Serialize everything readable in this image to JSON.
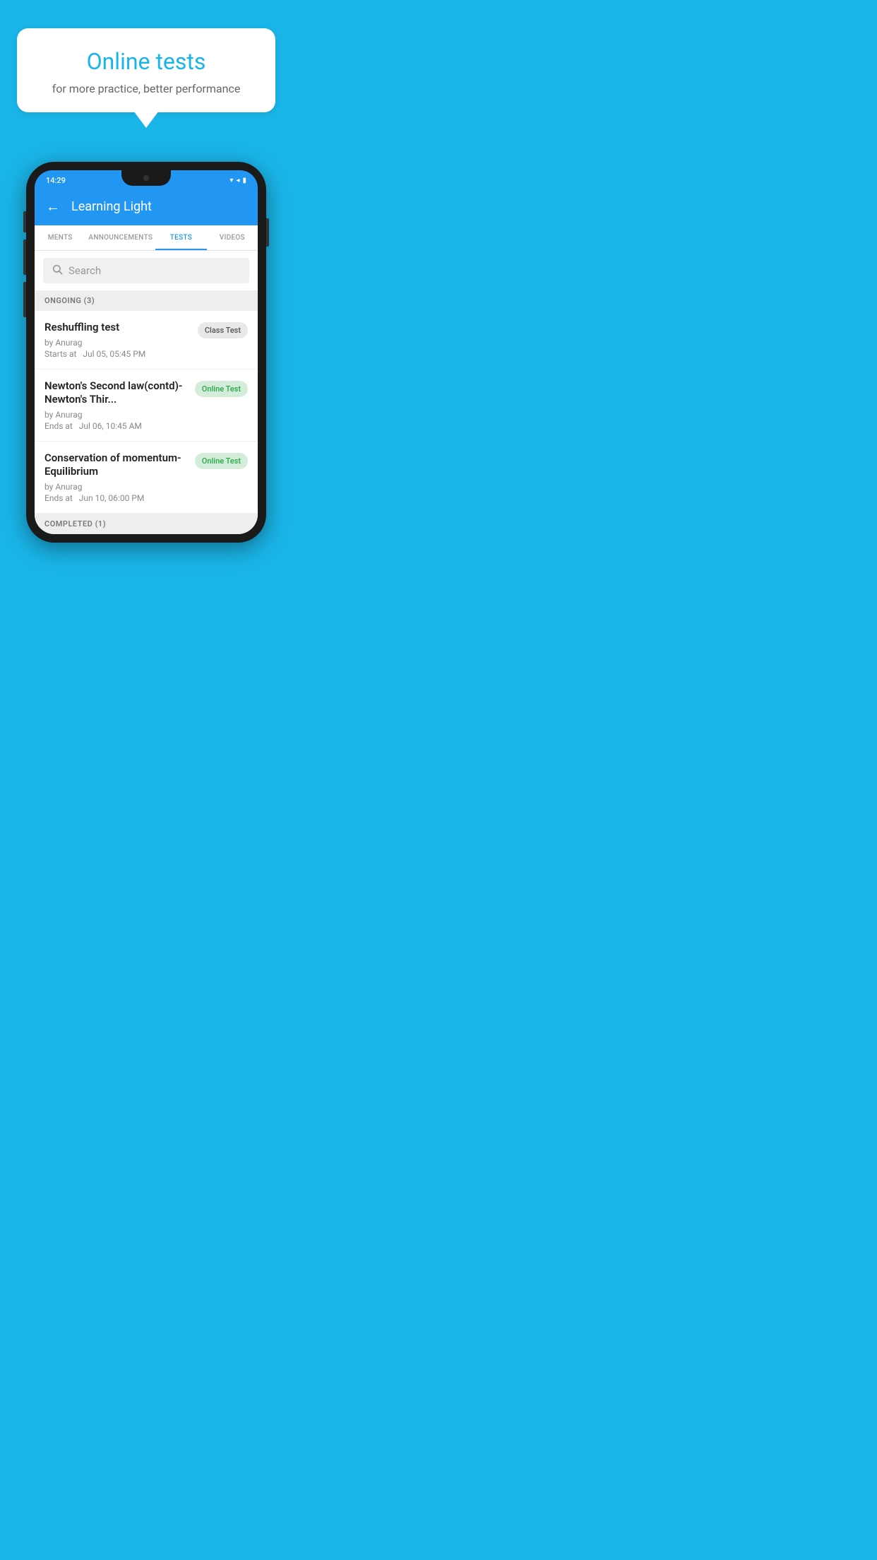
{
  "hero": {
    "bubble_title": "Online tests",
    "bubble_subtitle": "for more practice, better performance"
  },
  "phone": {
    "status_bar": {
      "time": "14:29",
      "icons": [
        "wifi",
        "signal",
        "battery"
      ]
    },
    "app_bar": {
      "title": "Learning Light",
      "back_label": "←"
    },
    "tabs": [
      {
        "label": "MENTS",
        "active": false
      },
      {
        "label": "ANNOUNCEMENTS",
        "active": false
      },
      {
        "label": "TESTS",
        "active": true
      },
      {
        "label": "VIDEOS",
        "active": false
      }
    ],
    "search": {
      "placeholder": "Search"
    },
    "sections": [
      {
        "header": "ONGOING (3)",
        "items": [
          {
            "name": "Reshuffling test",
            "by": "by Anurag",
            "time": "Starts at  Jul 05, 05:45 PM",
            "badge": "Class Test",
            "badge_type": "class"
          },
          {
            "name": "Newton's Second law(contd)-Newton's Thir...",
            "by": "by Anurag",
            "time": "Ends at  Jul 06, 10:45 AM",
            "badge": "Online Test",
            "badge_type": "online"
          },
          {
            "name": "Conservation of momentum-Equilibrium",
            "by": "by Anurag",
            "time": "Ends at  Jun 10, 06:00 PM",
            "badge": "Online Test",
            "badge_type": "online"
          }
        ]
      }
    ],
    "completed_header": "COMPLETED (1)"
  }
}
